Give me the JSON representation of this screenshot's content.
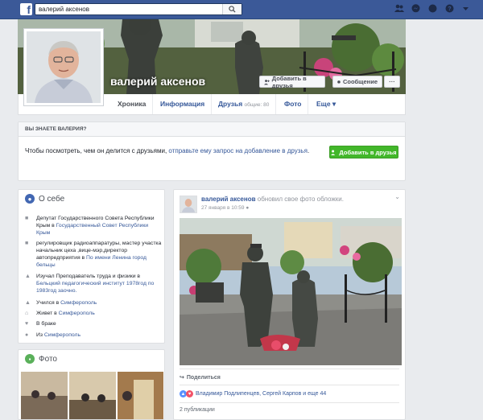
{
  "topbar": {
    "logo": "f",
    "search_value": "валерий аксенов",
    "icons": [
      "friends-icon",
      "messages-icon",
      "notifications-icon",
      "help-icon",
      "dropdown-icon"
    ]
  },
  "profile": {
    "name": "валерий аксенов",
    "add_friend_label": "Добавить в друзья",
    "message_label": "Сообщение",
    "more_label": "···"
  },
  "tabs": [
    {
      "label": "Хроника"
    },
    {
      "label": "Информация"
    },
    {
      "label": "Друзья",
      "count": "общие: 80"
    },
    {
      "label": "Фото"
    },
    {
      "label": "Еще ▾"
    }
  ],
  "know": {
    "title": "ВЫ ЗНАЕТЕ ВАЛЕРИЯ?",
    "text": "Чтобы посмотреть, чем он делится с друзьями, ",
    "link": "отправьте ему запрос на добавление в друзья",
    "suffix": ".",
    "button": "Добавить в друзья"
  },
  "about": {
    "title": "О себе",
    "items": [
      {
        "pre": "Депутат Государственного Совета Республики Крым в ",
        "link": "Государственный Совет Республики Крым",
        "post": ""
      },
      {
        "pre": "регулировщик радиоаппаратуры, мастер участка начальник цеха ,вице-мэр,директор автопредприятия в ",
        "link": "По имени Ленина город бельцы",
        "post": ""
      },
      {
        "pre": "Изучал Преподаватель труда и физики в ",
        "link": "Бельцкий педагогический институт 1978год по 1983год заочно.",
        "post": ""
      },
      {
        "pre": "Учился в ",
        "link": "Симферополь",
        "post": ""
      },
      {
        "pre": "Живет в ",
        "link": "Симферополь",
        "post": ""
      },
      {
        "pre": "В браке",
        "link": "",
        "post": ""
      },
      {
        "pre": "Из ",
        "link": "Симферополь",
        "post": ""
      }
    ]
  },
  "photos": {
    "title": "Фото"
  },
  "post": {
    "author": "валерий аксенов",
    "action": " обновил свое фото обложки.",
    "date": "27 января в 10:59",
    "share": "Поделиться",
    "likes": "Владимир Подлипенцев, Сергей Карпов и еще 44",
    "publications": "2 публикации"
  },
  "colors": {
    "brand": "#3b5998",
    "link": "#365899",
    "add": "#42b72a"
  }
}
